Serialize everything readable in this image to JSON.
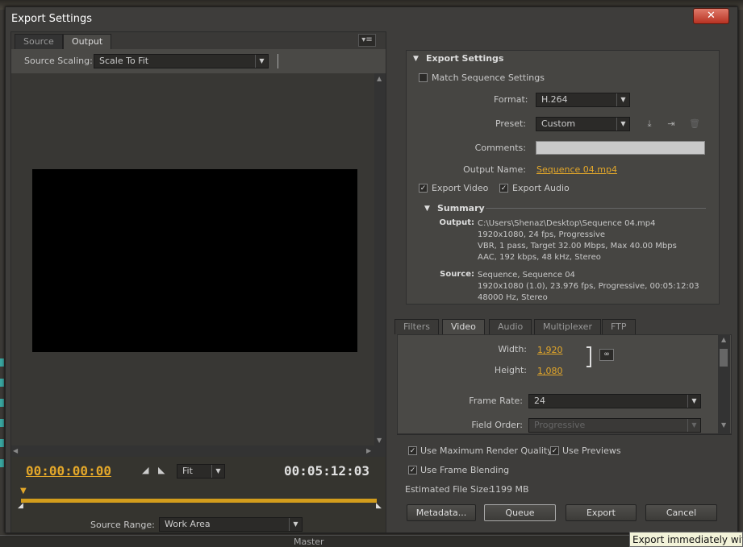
{
  "window": {
    "title": "Export Settings"
  },
  "left": {
    "tabs": [
      "Source",
      "Output"
    ],
    "source_scaling_label": "Source Scaling:",
    "source_scaling_value": "Scale To Fit",
    "timecode_start": "00:00:00:00",
    "timecode_end": "00:05:12:03",
    "fit_value": "Fit",
    "source_range_label": "Source Range:",
    "source_range_value": "Work Area"
  },
  "export": {
    "heading": "Export Settings",
    "match_sequence": "Match Sequence Settings",
    "format_label": "Format:",
    "format_value": "H.264",
    "preset_label": "Preset:",
    "preset_value": "Custom",
    "comments_label": "Comments:",
    "output_name_label": "Output Name:",
    "output_name_value": "Sequence 04.mp4",
    "export_video": "Export Video",
    "export_audio": "Export Audio"
  },
  "summary": {
    "heading": "Summary",
    "output_label": "Output:",
    "output_lines": [
      "C:\\Users\\Shenaz\\Desktop\\Sequence 04.mp4",
      "1920x1080, 24 fps, Progressive",
      "VBR, 1 pass, Target 32.00 Mbps, Max 40.00 Mbps",
      "AAC, 192 kbps, 48 kHz, Stereo"
    ],
    "source_label": "Source:",
    "source_lines": [
      "Sequence, Sequence 04",
      "1920x1080 (1.0), 23.976 fps, Progressive, 00:05:12:03",
      "48000 Hz, Stereo"
    ]
  },
  "settings_tabs": [
    "Filters",
    "Video",
    "Audio",
    "Multiplexer",
    "FTP"
  ],
  "video": {
    "width_label": "Width:",
    "width_value": "1,920",
    "height_label": "Height:",
    "height_value": "1,080",
    "frame_rate_label": "Frame Rate:",
    "frame_rate_value": "24",
    "field_order_label": "Field Order:",
    "field_order_value": "Progressive"
  },
  "options": {
    "max_render": "Use Maximum Render Quality",
    "use_previews": "Use Previews",
    "frame_blending": "Use Frame Blending",
    "file_size_label": "Estimated File Size:",
    "file_size_value": "1199 MB"
  },
  "buttons": {
    "metadata": "Metadata...",
    "queue": "Queue",
    "export": "Export",
    "cancel": "Cancel"
  },
  "background": {
    "master_label": "Master"
  },
  "tooltip": "Export immediately with"
}
